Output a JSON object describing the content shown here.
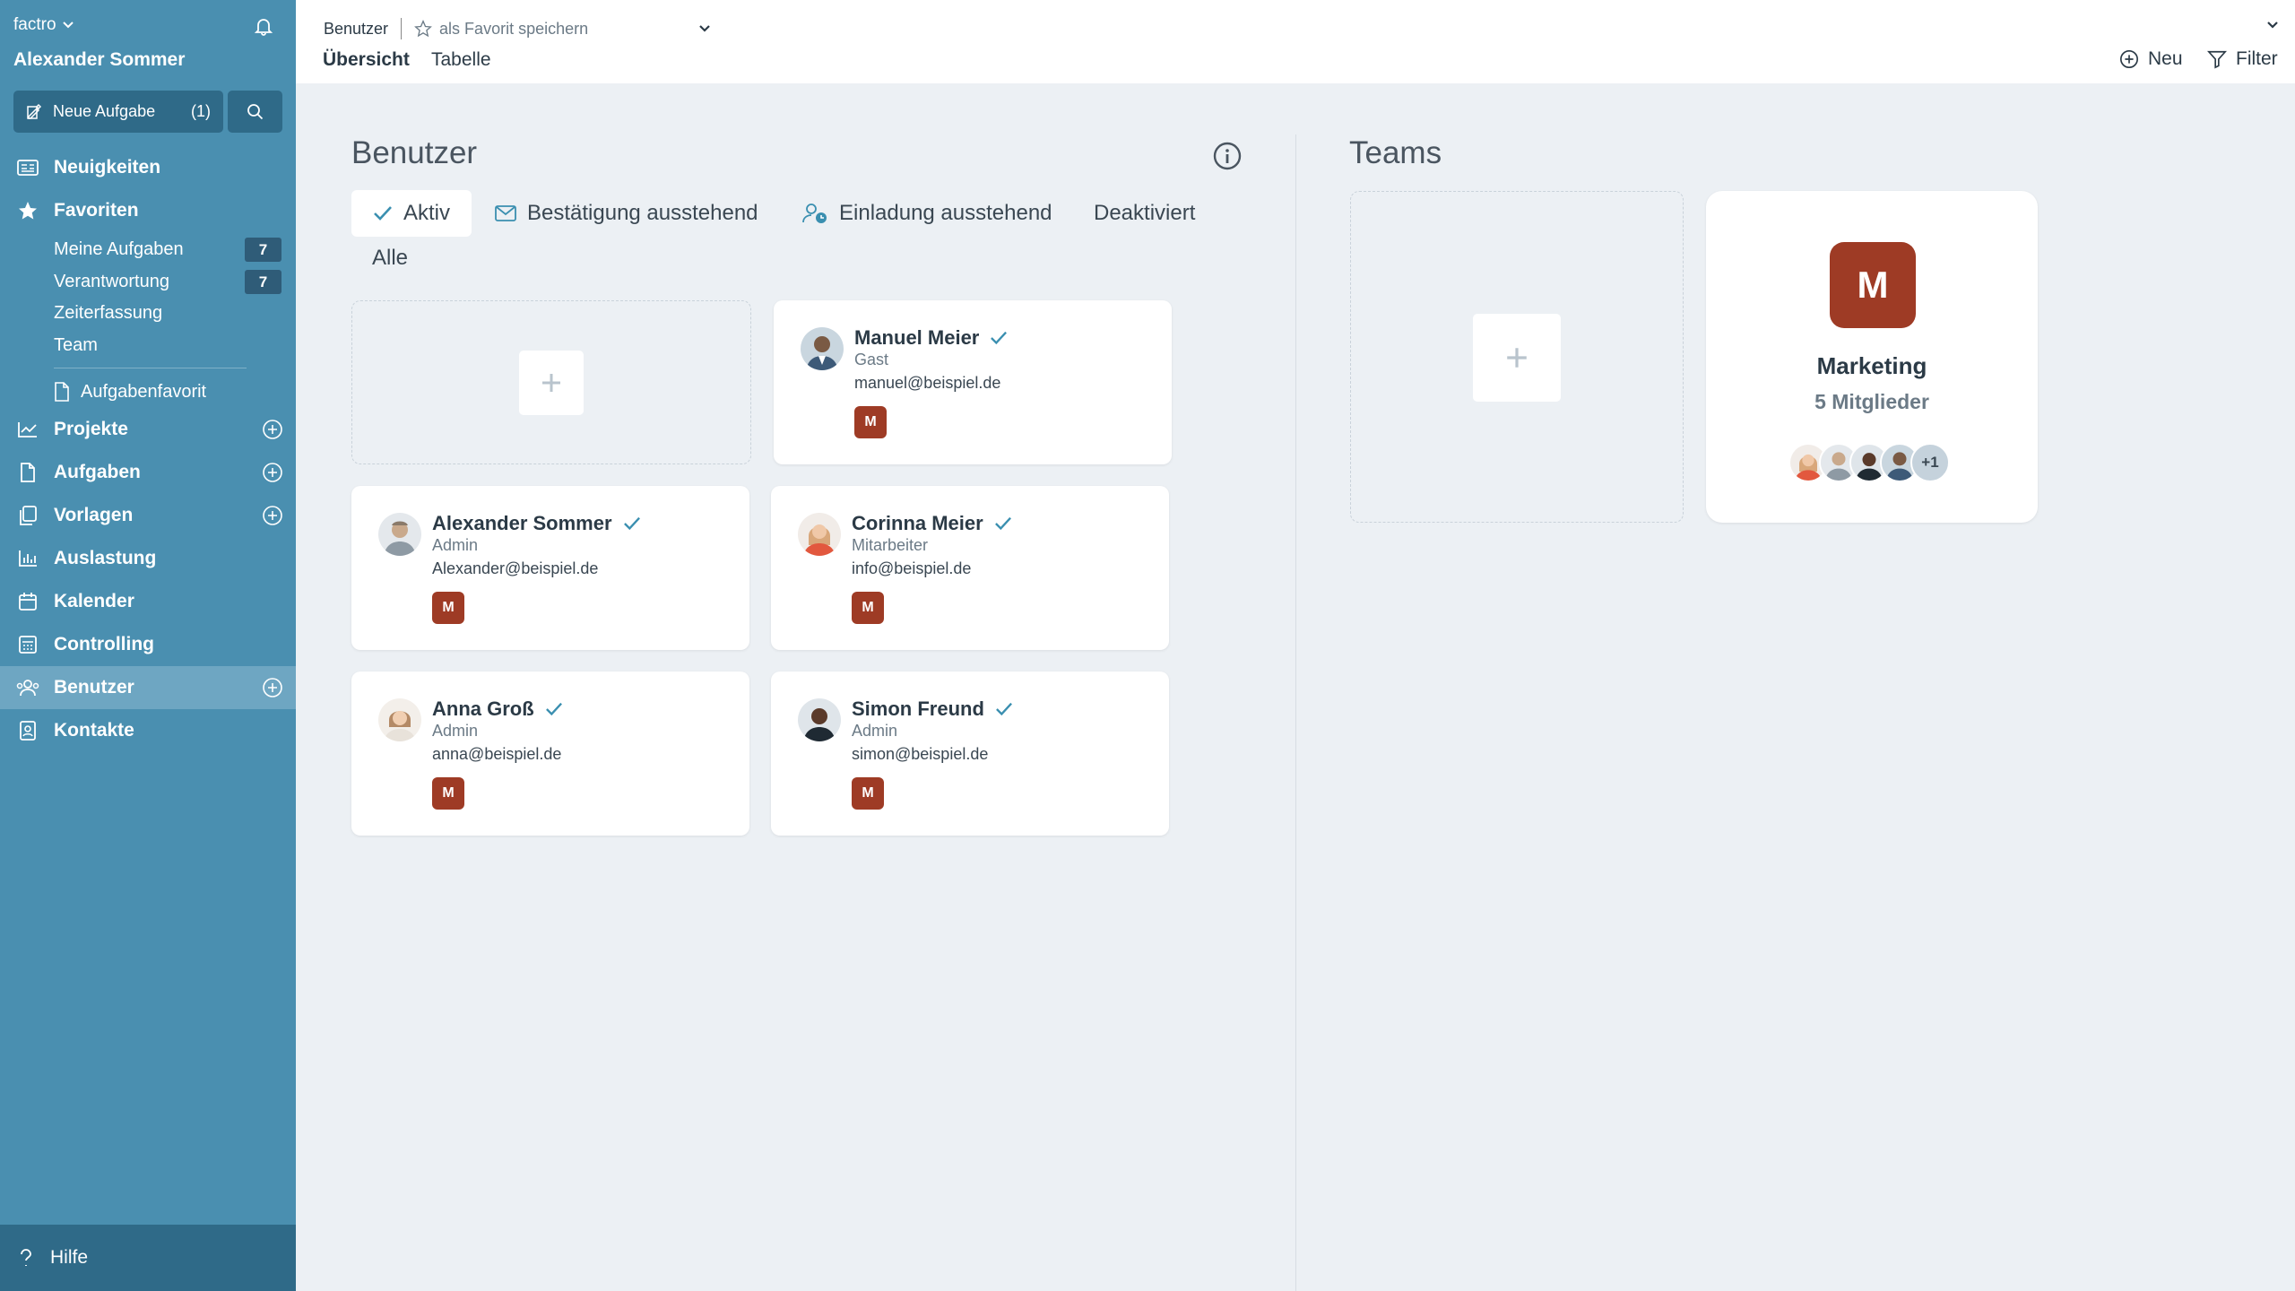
{
  "sidebar": {
    "brand": "factro",
    "user_name": "Alexander Sommer",
    "new_task": {
      "label": "Neue Aufgabe",
      "count": "(1)"
    },
    "nav": {
      "news": "Neuigkeiten",
      "favorites": "Favoriten",
      "projects": "Projekte",
      "tasks": "Aufgaben",
      "templates": "Vorlagen",
      "workload": "Auslastung",
      "calendar": "Kalender",
      "controlling": "Controlling",
      "users": "Benutzer",
      "contacts": "Kontakte"
    },
    "favorites_sub": [
      {
        "label": "Meine Aufgaben",
        "badge": "7"
      },
      {
        "label": "Verantwortung",
        "badge": "7"
      },
      {
        "label": "Zeiterfassung"
      },
      {
        "label": "Team"
      }
    ],
    "favorite_link": "Aufgabenfavorit",
    "help": "Hilfe"
  },
  "topbar": {
    "breadcrumb": "Benutzer",
    "save_favorite": "als Favorit speichern",
    "tabs": [
      "Übersicht",
      "Tabelle"
    ],
    "new_label": "Neu",
    "filter_label": "Filter"
  },
  "users_section": {
    "title": "Benutzer",
    "filters": {
      "active": "Aktiv",
      "pending_confirmation": "Bestätigung ausstehend",
      "pending_invitation": "Einladung ausstehend",
      "deactivated": "Deaktiviert",
      "all": "Alle"
    },
    "users": [
      {
        "name": "Manuel Meier",
        "role": "Gast",
        "email": "manuel@beispiel.de",
        "team": "M"
      },
      {
        "name": "Alexander Sommer",
        "role": "Admin",
        "email": "Alexander@beispiel.de",
        "team": "M"
      },
      {
        "name": "Corinna Meier",
        "role": "Mitarbeiter",
        "email": "info@beispiel.de",
        "team": "M"
      },
      {
        "name": "Anna Groß",
        "role": "Admin",
        "email": "anna@beispiel.de",
        "team": "M"
      },
      {
        "name": "Simon Freund",
        "role": "Admin",
        "email": "simon@beispiel.de",
        "team": "M"
      }
    ]
  },
  "teams_section": {
    "title": "Teams",
    "team": {
      "initial": "M",
      "name": "Marketing",
      "members": "5 Mitglieder",
      "more": "+1"
    }
  },
  "colors": {
    "sidebar": "#4a8fb0",
    "sidebar_dark": "#2f6a88",
    "team_badge": "#9e3b25",
    "check": "#3a8fb0"
  }
}
